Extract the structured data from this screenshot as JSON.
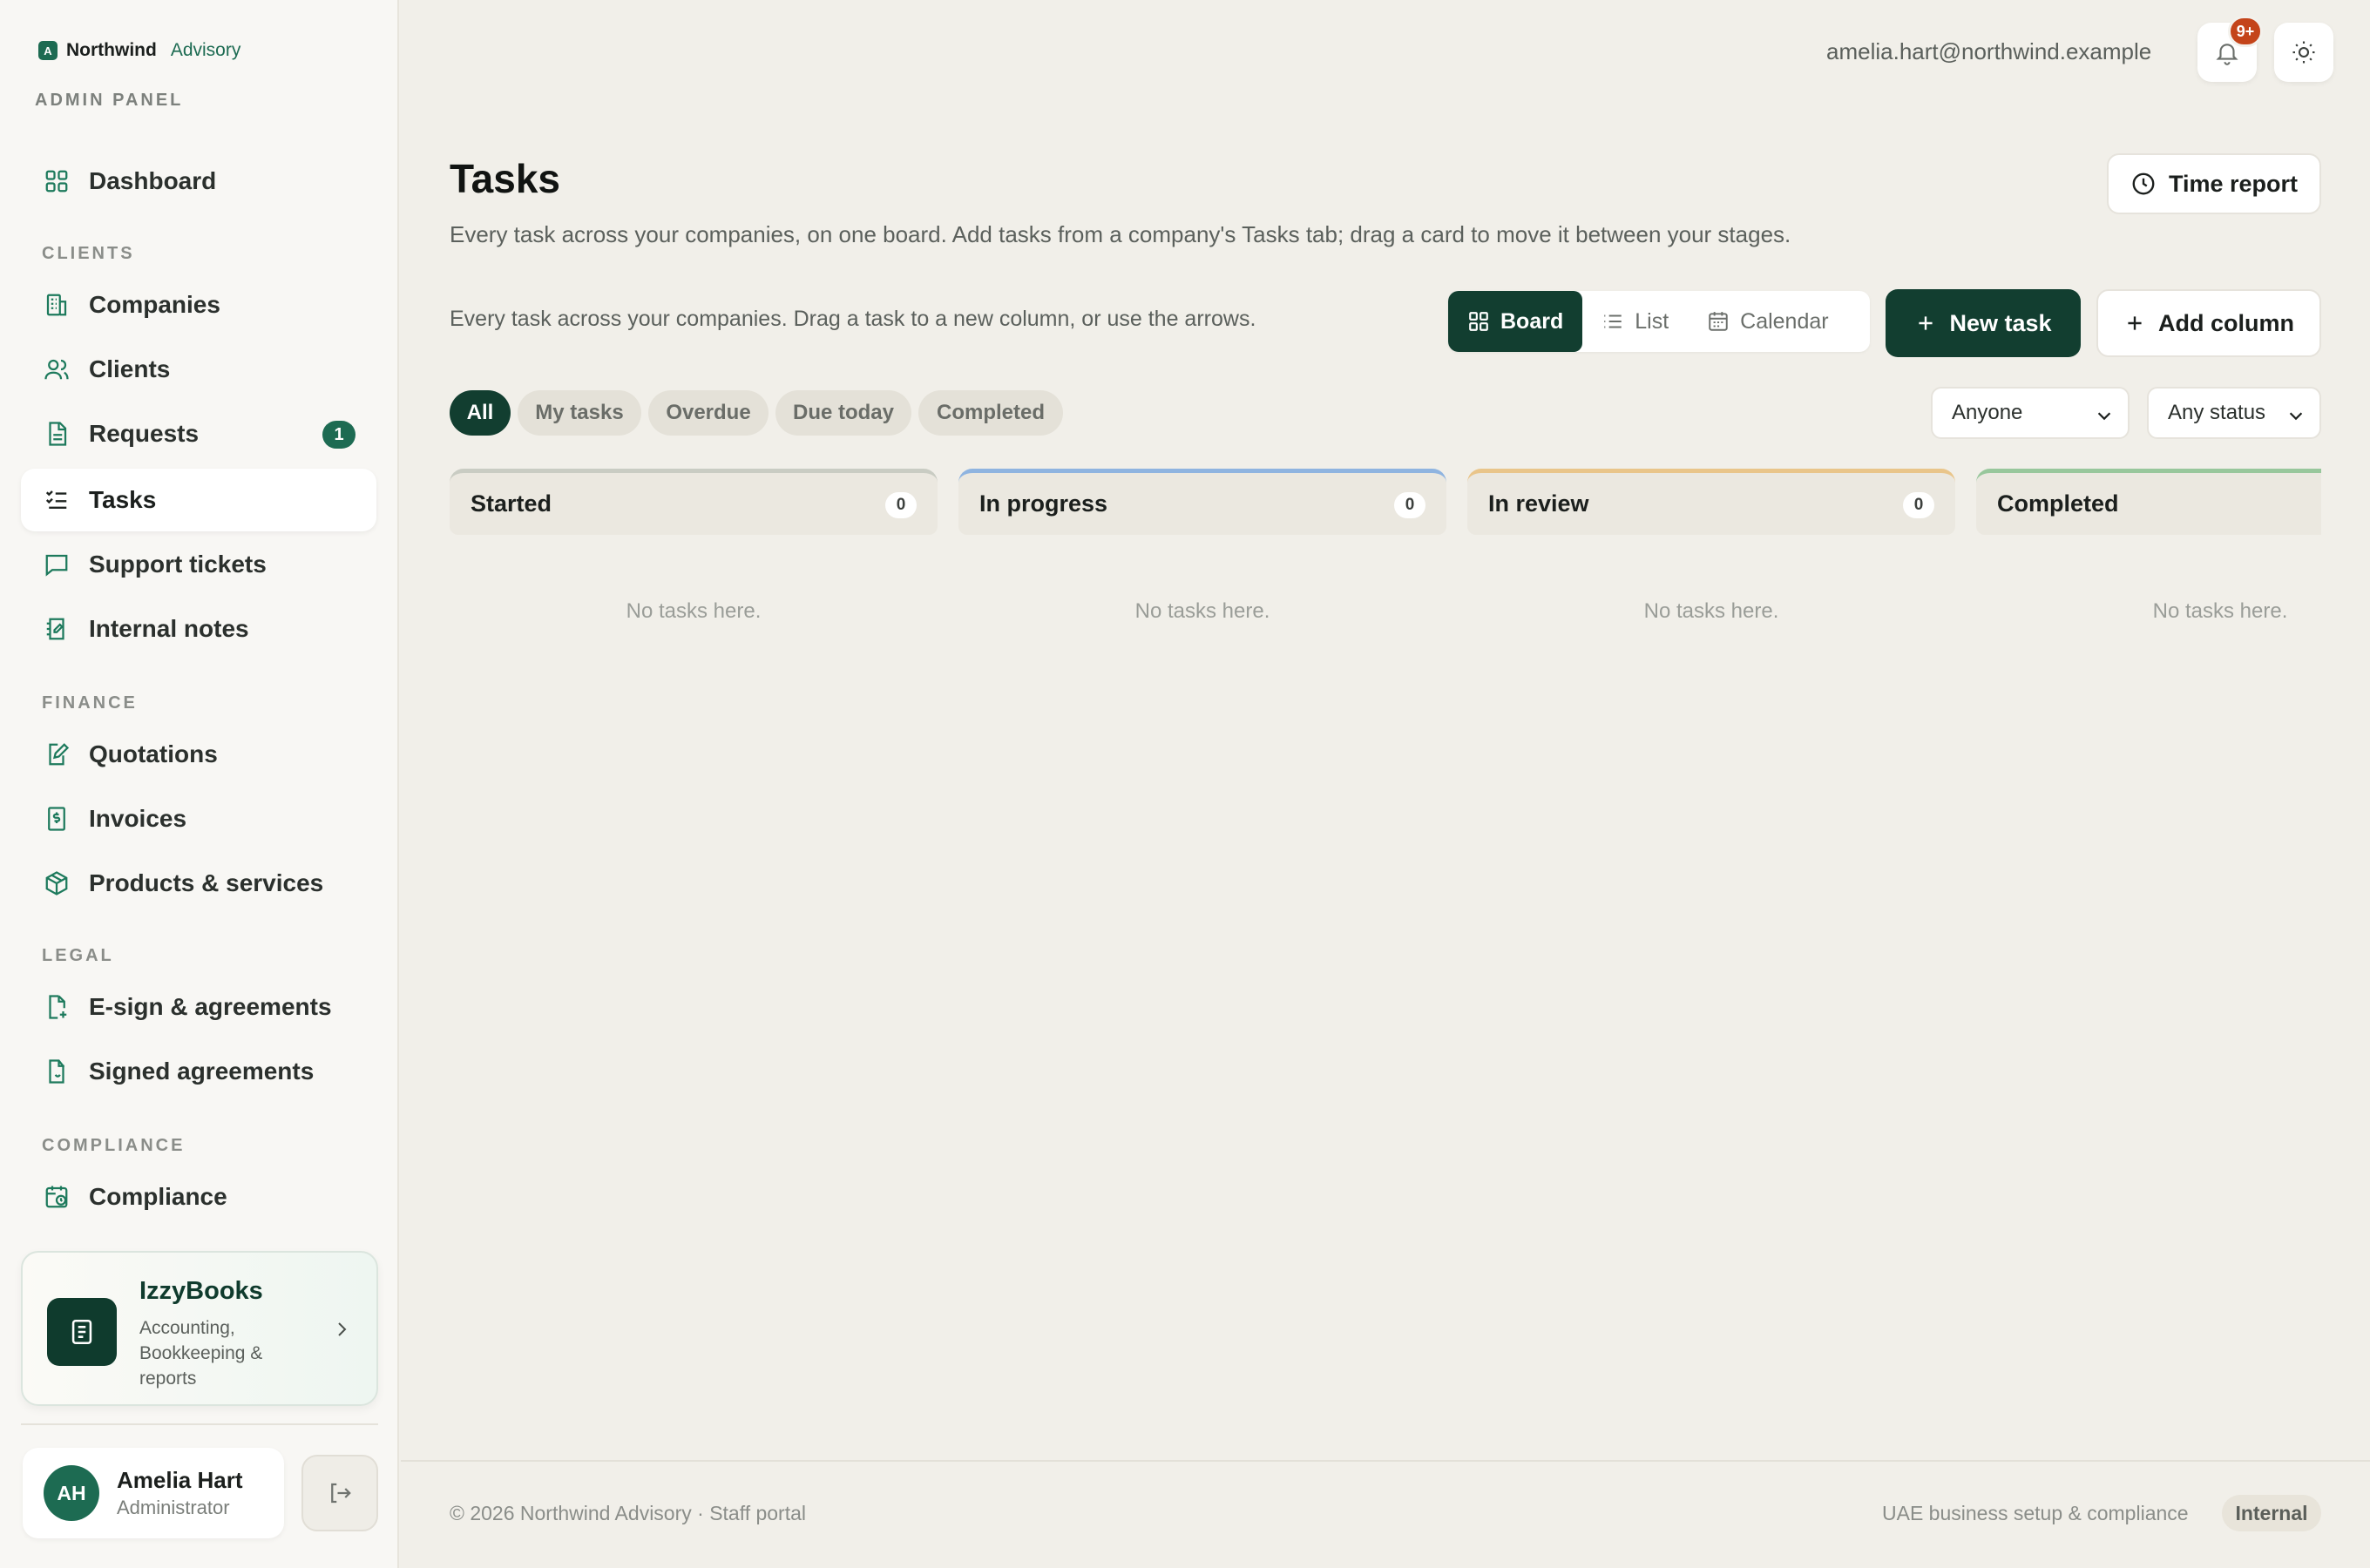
{
  "brand": {
    "name": "Northwind",
    "suffix": "Advisory",
    "logo_letter": "A",
    "panel_label": "ADMIN PANEL"
  },
  "sidebar": {
    "dashboard": {
      "label": "Dashboard",
      "icon": "grid-icon"
    },
    "sections": {
      "clients": "CLIENTS",
      "finance": "FINANCE",
      "legal": "LEGAL",
      "compliance": "COMPLIANCE"
    },
    "items": {
      "companies": {
        "label": "Companies",
        "icon": "building-icon"
      },
      "clients": {
        "label": "Clients",
        "icon": "users-icon"
      },
      "requests": {
        "label": "Requests",
        "icon": "document-icon",
        "badge": "1"
      },
      "tasks": {
        "label": "Tasks",
        "icon": "checklist-icon",
        "active": true
      },
      "support": {
        "label": "Support tickets",
        "icon": "chat-icon"
      },
      "notes": {
        "label": "Internal notes",
        "icon": "notebook-icon"
      },
      "quotations": {
        "label": "Quotations",
        "icon": "edit-document-icon"
      },
      "invoices": {
        "label": "Invoices",
        "icon": "invoice-icon"
      },
      "products": {
        "label": "Products & services",
        "icon": "package-icon"
      },
      "esign": {
        "label": "E-sign & agreements",
        "icon": "file-plus-icon"
      },
      "signed": {
        "label": "Signed agreements",
        "icon": "file-check-icon"
      },
      "compliance": {
        "label": "Compliance",
        "icon": "calendar-clock-icon"
      }
    },
    "promo": {
      "title": "IzzyBooks",
      "description": "Accounting, Bookkeeping & reports"
    },
    "user": {
      "initials": "AH",
      "name": "Amelia Hart",
      "role": "Administrator"
    }
  },
  "topbar": {
    "email": "amelia.hart@northwind.example",
    "notifications_badge": "9+"
  },
  "header": {
    "title": "Tasks",
    "subtitle": "Every task across your companies, on one board. Add tasks from a company's Tasks tab; drag a card to move it between your stages.",
    "time_report_label": "Time report"
  },
  "board_toolbar": {
    "hint": "Every task across your companies. Drag a task to a new column, or use the arrows.",
    "views": {
      "board": "Board",
      "list": "List",
      "calendar": "Calendar"
    },
    "active_view": "Board",
    "new_task_label": "New task",
    "add_column_label": "Add column"
  },
  "filters": {
    "chips": {
      "all": "All",
      "mine": "My tasks",
      "overdue": "Overdue",
      "today": "Due today",
      "completed": "Completed"
    },
    "active_chip": "All",
    "assignee": "Anyone",
    "status": "Any status"
  },
  "columns": [
    {
      "title": "Started",
      "count": "0",
      "empty_text": "No tasks here.",
      "accent": "#c9ccc3"
    },
    {
      "title": "In progress",
      "count": "0",
      "empty_text": "No tasks here.",
      "accent": "#8fb4e0"
    },
    {
      "title": "In review",
      "count": "0",
      "empty_text": "No tasks here.",
      "accent": "#e9c58a"
    },
    {
      "title": "Completed",
      "count": "",
      "empty_text": "No tasks here.",
      "accent": "#98c79c"
    }
  ],
  "footer": {
    "copyright": "© 2026 Northwind Advisory · Staff portal",
    "tagline": "UAE business setup & compliance",
    "badge": "Internal"
  },
  "colors": {
    "primary": "#123e30",
    "accent_green": "#1d6b52",
    "notification": "#c4441a"
  }
}
